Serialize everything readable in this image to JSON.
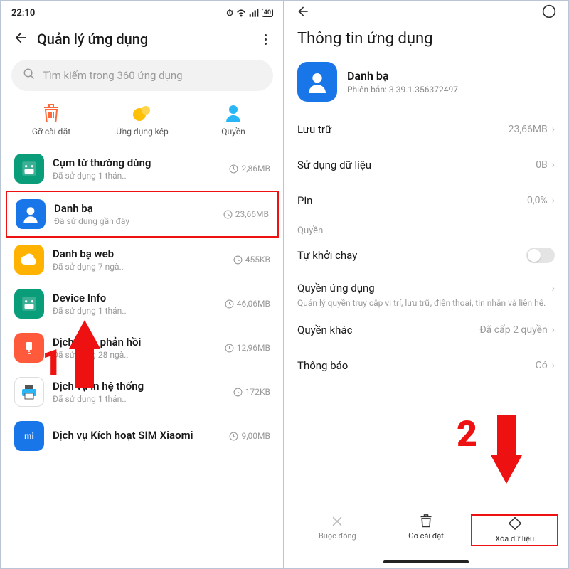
{
  "left": {
    "time": "22:10",
    "battery": "40",
    "title": "Quản lý ứng dụng",
    "search_placeholder": "Tìm kiếm trong 360 ứng dụng",
    "actions": {
      "uninstall": "Gỡ cài đặt",
      "dual": "Ứng dụng kép",
      "perms": "Quyền"
    },
    "apps": [
      {
        "name": "Cụm từ thường dùng",
        "sub": "Đã sử dụng 1 thán..",
        "size": "2,86MB",
        "bg": "#0a9d7a",
        "ico": "android"
      },
      {
        "name": "Danh bạ",
        "sub": "Đã sử dụng gần đây",
        "size": "23,66MB",
        "bg": "#1976e8",
        "ico": "person",
        "hl": true
      },
      {
        "name": "Danh bạ web",
        "sub": "Đã sử dụng 7 ngà..",
        "size": "455KB",
        "bg": "#ffb300",
        "ico": "cloud"
      },
      {
        "name": "Device Info",
        "sub": "Đã sử dụng 1 thán..",
        "size": "46,06MB",
        "bg": "#0a9d7a",
        "ico": "android"
      },
      {
        "name": "Dịch vụ & phản hồi",
        "sub": "Đã sử dụng 28 ngà..",
        "size": "12,96MB",
        "bg": "#ff5a3c",
        "ico": "mi"
      },
      {
        "name": "Dịch vụ in hệ thống",
        "sub": "Đã sử dụng 1 thán..",
        "size": "172KB",
        "bg": "#ffffff",
        "ico": "print"
      },
      {
        "name": "Dịch vụ Kích hoạt SIM Xiaomi",
        "sub": "",
        "size": "9,00MB",
        "bg": "#1976e8",
        "ico": "mi2"
      }
    ]
  },
  "right": {
    "title": "Thông tin ứng dụng",
    "app_name": "Danh bạ",
    "version": "Phiên bản: 3.39.1.356372497",
    "rows": {
      "storage": {
        "label": "Lưu trữ",
        "val": "23,66MB"
      },
      "data": {
        "label": "Sử dụng dữ liệu",
        "val": "0B"
      },
      "battery": {
        "label": "Pin",
        "val": "0,0%"
      }
    },
    "perm_section": "Quyền",
    "autostart": "Tự khởi chạy",
    "app_perms": {
      "title": "Quyền ứng dụng",
      "sub": "Quản lý quyền truy cập vị trí, lưu trữ, điện thoại, tin nhắn và liên hệ."
    },
    "other_perms": {
      "label": "Quyền khác",
      "val": "Đã cấp 2 quyền"
    },
    "notif": {
      "label": "Thông báo",
      "val": "Có"
    },
    "bottom": {
      "force": "Buộc đóng",
      "uninstall": "Gỡ cài đặt",
      "clear": "Xóa dữ liệu"
    }
  },
  "anno": {
    "one": "1",
    "two": "2"
  }
}
